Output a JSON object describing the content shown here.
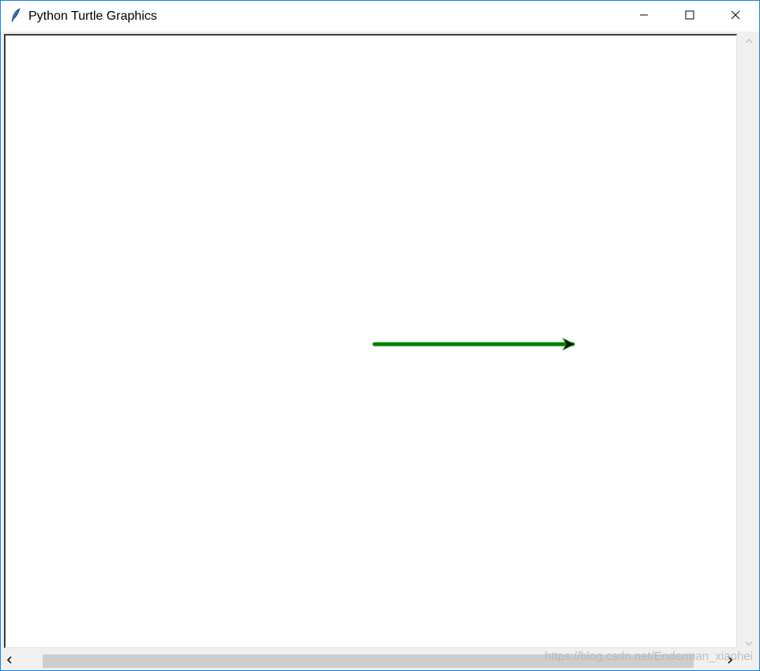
{
  "window": {
    "title": "Python Turtle Graphics",
    "app_icon": "tk-feather-icon",
    "controls": {
      "minimize_icon": "minimize-icon",
      "maximize_icon": "maximize-icon",
      "close_icon": "close-icon"
    }
  },
  "canvas": {
    "background": "#ffffff",
    "pen_color": "#008000",
    "turtle_color": "#000000",
    "turtle_shape": "classic-arrow-icon"
  },
  "scrollbars": {
    "vertical": {
      "up_icon": "chevron-up-icon",
      "down_icon": "chevron-down-icon"
    },
    "horizontal": {
      "left_icon": "chevron-left-icon",
      "right_icon": "chevron-right-icon"
    }
  },
  "watermark": {
    "text": "https://blog.csdn.net/Enderman_xiaohei"
  }
}
